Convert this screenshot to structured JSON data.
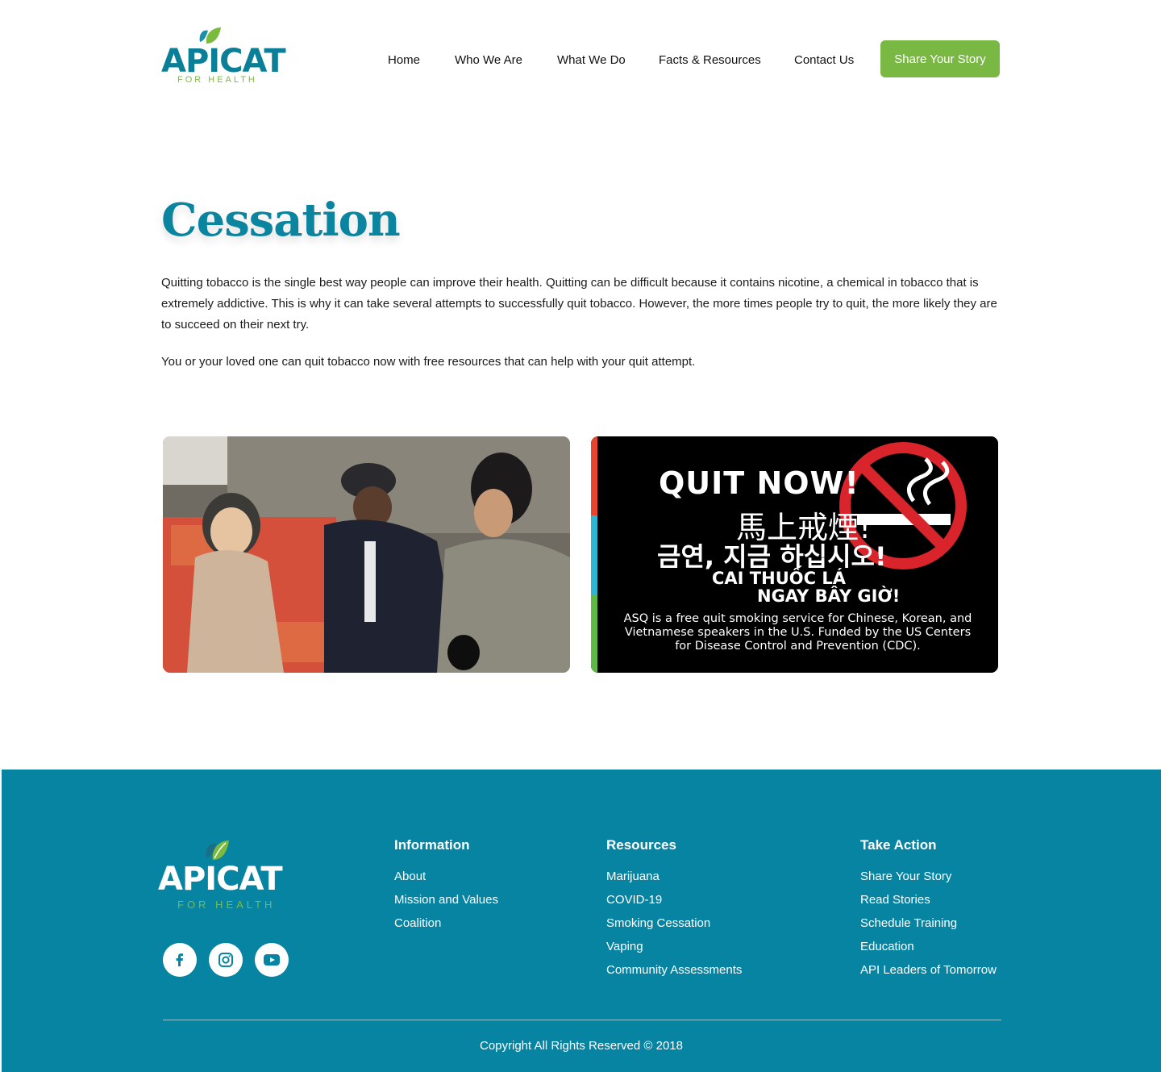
{
  "brand": {
    "name": "APICAT",
    "tagline": "FOR HEALTH",
    "colors": {
      "teal": "#0784a2",
      "green": "#78b843",
      "title": "#0b84a0"
    }
  },
  "nav": {
    "items": [
      "Home",
      "Who We Are",
      "What We Do",
      "Facts & Resources",
      "Contact Us"
    ],
    "cta": "Share Your Story"
  },
  "main": {
    "title": "Cessation",
    "paragraph1": "Quitting tobacco is the single best way people can improve their health. Quitting can be difficult because it contains nicotine, a chemical in tobacco that is extremely addictive. This is why it can take several attempts to successfully quit tobacco. However, the more times people try to quit, the more likely they are to succeed on their next try.",
    "paragraph2": "You or your loved one can quit tobacco now with free resources that can help with your quit attempt."
  },
  "quit_banner": {
    "line_en": "QUIT NOW!",
    "line_zh": "馬上戒煙!",
    "line_ko": "금연, 지금 하십시오!",
    "line_vi1": "CAI THUỐC LÁ",
    "line_vi2": "NGAY BÂY GIỜ!",
    "caption1": "ASQ is a free quit smoking service for Chinese, Korean, and",
    "caption2": "Vietnamese speakers in the U.S. Funded by the US Centers",
    "caption3": "for Disease Control and Prevention (CDC)."
  },
  "footer": {
    "social": [
      "facebook-icon",
      "instagram-icon",
      "youtube-icon"
    ],
    "columns": [
      {
        "heading": "Information",
        "links": [
          "About",
          "Mission and Values",
          "Coalition"
        ]
      },
      {
        "heading": "Resources",
        "links": [
          "Marijuana",
          "COVID-19",
          "Smoking Cessation",
          "Vaping",
          "Community Assessments"
        ]
      },
      {
        "heading": "Take Action",
        "links": [
          "Share Your Story",
          "Read Stories",
          "Schedule Training",
          "Education",
          "API Leaders of Tomorrow"
        ]
      }
    ],
    "copyright": "Copyright All Rights Reserved © 2018"
  }
}
